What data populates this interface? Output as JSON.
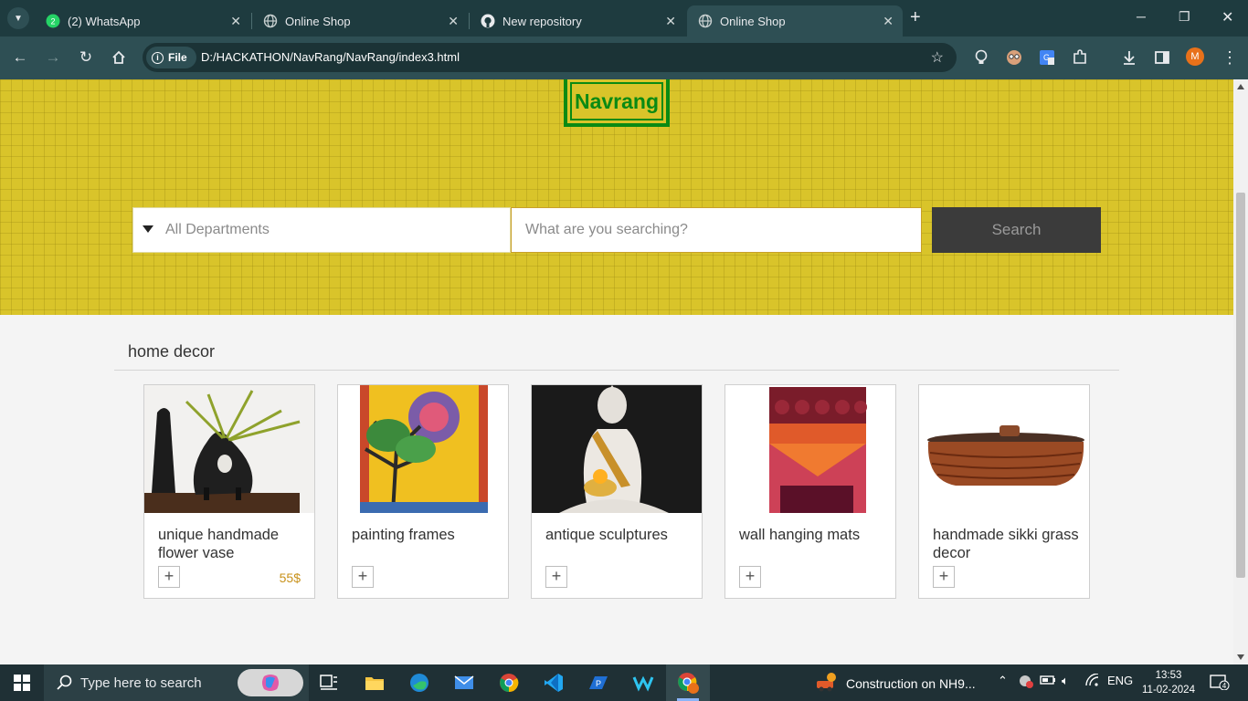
{
  "browser": {
    "tabs": [
      {
        "label": "(2) WhatsApp",
        "badge": "2",
        "active": false
      },
      {
        "label": "Online Shop",
        "active": false
      },
      {
        "label": "New repository",
        "active": false
      },
      {
        "label": "Online Shop",
        "active": true
      }
    ],
    "site_chip": "File",
    "url": "D:/HACKATHON/NavRang/NavRang/index3.html",
    "profile_initial": "M"
  },
  "page": {
    "logo": "Navrang",
    "departments_label": "All Departments",
    "search_placeholder": "What are you searching?",
    "search_button": "Search",
    "section_title": "home decor",
    "products": [
      {
        "title": "unique handmade flower vase",
        "price": "55$",
        "add": "+"
      },
      {
        "title": "painting frames",
        "price": "",
        "add": "+"
      },
      {
        "title": "antique sculptures",
        "price": "",
        "add": "+"
      },
      {
        "title": "wall hanging mats",
        "price": "",
        "add": "+"
      },
      {
        "title": "handmade sikki grass decor",
        "price": "",
        "add": "+"
      }
    ]
  },
  "taskbar": {
    "search_placeholder": "Type here to search",
    "news": "Construction on NH9...",
    "language": "ENG",
    "time": "13:53",
    "date": "11-02-2024",
    "notifications": "4"
  },
  "colors": {
    "hero": "#d9c42a",
    "logo_green": "#0a8a13",
    "price": "#c8911a",
    "chrome": "#1e3b3f"
  }
}
